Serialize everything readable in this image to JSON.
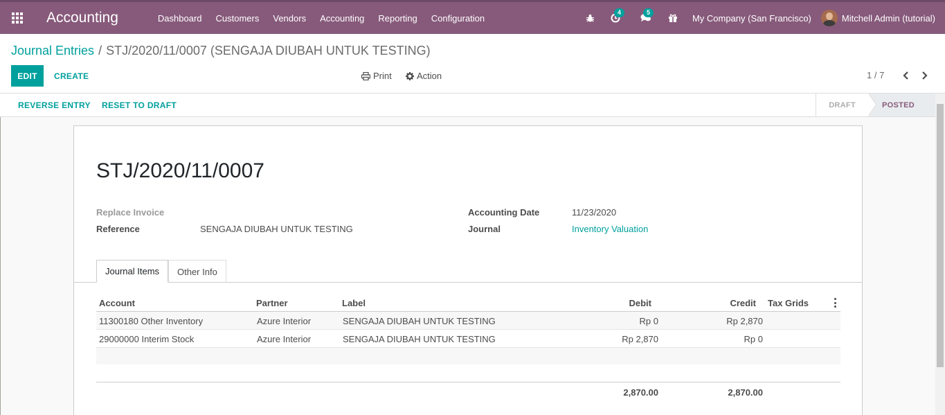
{
  "navbar": {
    "app_name": "Accounting",
    "menu": [
      "Dashboard",
      "Customers",
      "Vendors",
      "Accounting",
      "Reporting",
      "Configuration"
    ],
    "activity_count": "4",
    "messages_count": "5",
    "company": "My Company (San Francisco)",
    "user": "Mitchell Admin (tutorial)"
  },
  "breadcrumb": {
    "parent": "Journal Entries",
    "separator": "/",
    "current": "STJ/2020/11/0007 (SENGAJA DIUBAH UNTUK TESTING)"
  },
  "toolbar": {
    "edit_label": "EDIT",
    "create_label": "CREATE",
    "print_label": "Print",
    "action_label": "Action"
  },
  "pager": {
    "value": "1 / 7"
  },
  "statusbar": {
    "reverse_label": "REVERSE ENTRY",
    "reset_label": "RESET TO DRAFT",
    "stages": [
      "DRAFT",
      "POSTED"
    ],
    "active_stage": "POSTED"
  },
  "record": {
    "name": "STJ/2020/11/0007",
    "replace_invoice_label": "Replace Invoice",
    "reference_label": "Reference",
    "reference_value": "SENGAJA DIUBAH UNTUK TESTING",
    "accounting_date_label": "Accounting Date",
    "accounting_date_value": "11/23/2020",
    "journal_label": "Journal",
    "journal_value": "Inventory Valuation"
  },
  "tabs": {
    "journal_items": "Journal Items",
    "other_info": "Other Info"
  },
  "table": {
    "headers": {
      "account": "Account",
      "partner": "Partner",
      "label": "Label",
      "debit": "Debit",
      "credit": "Credit",
      "tax_grids": "Tax Grids"
    },
    "rows": [
      {
        "account": "11300180 Other Inventory",
        "partner": "Azure Interior",
        "label": "SENGAJA DIUBAH UNTUK TESTING",
        "debit": "Rp 0",
        "credit": "Rp 2,870"
      },
      {
        "account": "29000000 Interim Stock",
        "partner": "Azure Interior",
        "label": "SENGAJA DIUBAH UNTUK TESTING",
        "debit": "Rp 2,870",
        "credit": "Rp 0"
      }
    ],
    "total_debit": "2,870.00",
    "total_credit": "2,870.00"
  },
  "colors": {
    "brand": "#875a7b",
    "accent": "#00a09d"
  },
  "icons": [
    "apps-grid-icon",
    "bug-icon",
    "activity-clock-icon",
    "chat-icon",
    "gift-icon",
    "print-icon",
    "gear-icon",
    "chevron-left-icon",
    "chevron-right-icon",
    "kebab-menu-icon"
  ]
}
